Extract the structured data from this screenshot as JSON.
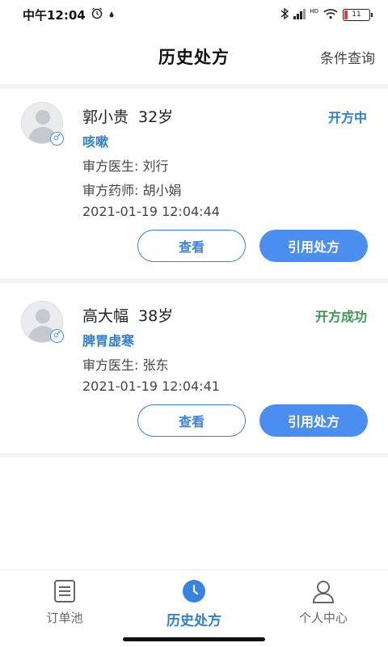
{
  "status_bar": {
    "time": "中午12:04",
    "alarm_icon": "alarm-icon",
    "signal_text": "HD",
    "battery_level": "11"
  },
  "header": {
    "title": "历史处方",
    "action": "条件查询"
  },
  "prescriptions": [
    {
      "name": "郭小贵",
      "age": "32岁",
      "diagnosis": "咳嗽",
      "status": "开方中",
      "status_color": "#2f7fd6",
      "doctor": "审方医生: 刘行",
      "pharmacist": "审方药师: 胡小娟",
      "datetime": "2021-01-19 12:04:44",
      "view_label": "查看",
      "cite_label": "引用处方"
    },
    {
      "name": "高大幅",
      "age": "38岁",
      "diagnosis": "脾胃虚寒",
      "status": "开方成功",
      "status_color": "#3d9a53",
      "doctor": "审方医生: 张东",
      "datetime": "2021-01-19 12:04:41",
      "view_label": "查看",
      "cite_label": "引用处方"
    }
  ],
  "tabs": [
    {
      "label": "订单池",
      "icon": "order-list-icon"
    },
    {
      "label": "历史处方",
      "icon": "clock-icon",
      "active": true
    },
    {
      "label": "个人中心",
      "icon": "person-icon"
    }
  ],
  "colors": {
    "accent": "#4a8ef0",
    "link_blue": "#2f7fd6",
    "success_green": "#3d9a53"
  }
}
